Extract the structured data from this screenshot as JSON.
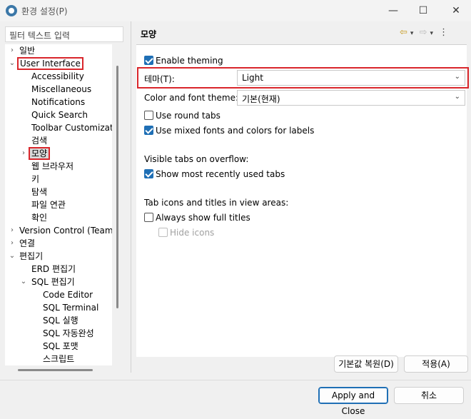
{
  "window": {
    "title": "환경 설정(P)",
    "minimize_glyph": "—",
    "maximize_glyph": "☐",
    "close_glyph": "✕"
  },
  "filter": {
    "value": "필터 텍스트 입력"
  },
  "tree": {
    "general": "일반",
    "user_interface": "User Interface",
    "accessibility": "Accessibility",
    "miscellaneous": "Miscellaneous",
    "notifications": "Notifications",
    "quick_search": "Quick Search",
    "toolbar_customization": "Toolbar Customizatic",
    "search": "검색",
    "appearance": "모양",
    "web_browser": "웹 브라우저",
    "keys": "키",
    "explorer": "탐색",
    "file_assoc": "파일 연관",
    "confirm": "확인",
    "version_control": "Version Control (Team)",
    "connection": "연결",
    "editors": "편집기",
    "erd_editor": "ERD 편집기",
    "sql_editor": "SQL 편집기",
    "code_editor": "Code Editor",
    "sql_terminal": "SQL Terminal",
    "sql_execute": "SQL 실행",
    "sql_autocomplete": "SQL 자동완성",
    "sql_format": "SQL 포맷",
    "script": "스크립트"
  },
  "page": {
    "title": "모양",
    "enable_theming": "Enable theming",
    "theme_label": "테마(T):",
    "theme_value": "Light",
    "color_font_label": "Color and font theme:",
    "color_font_value": "기본(현재)",
    "round_tabs": "Use round tabs",
    "mixed_fonts": "Use mixed fonts and colors for labels",
    "visible_tabs_heading": "Visible tabs on overflow:",
    "show_recent_tabs": "Show most recently used tabs",
    "tab_icons_heading": "Tab icons and titles in view areas:",
    "always_full_titles": "Always show full titles",
    "hide_icons": "Hide icons"
  },
  "checkboxes": {
    "enable_theming": true,
    "round_tabs": false,
    "mixed_fonts": true,
    "show_recent_tabs": true,
    "always_full_titles": false,
    "hide_icons": false
  },
  "buttons": {
    "restore_defaults": "기본값 복원(D)",
    "apply": "적용(A)",
    "apply_close": "Apply and Close",
    "cancel": "취소"
  },
  "colors": {
    "accent": "#1f6fb5",
    "highlight": "#d9262b"
  }
}
